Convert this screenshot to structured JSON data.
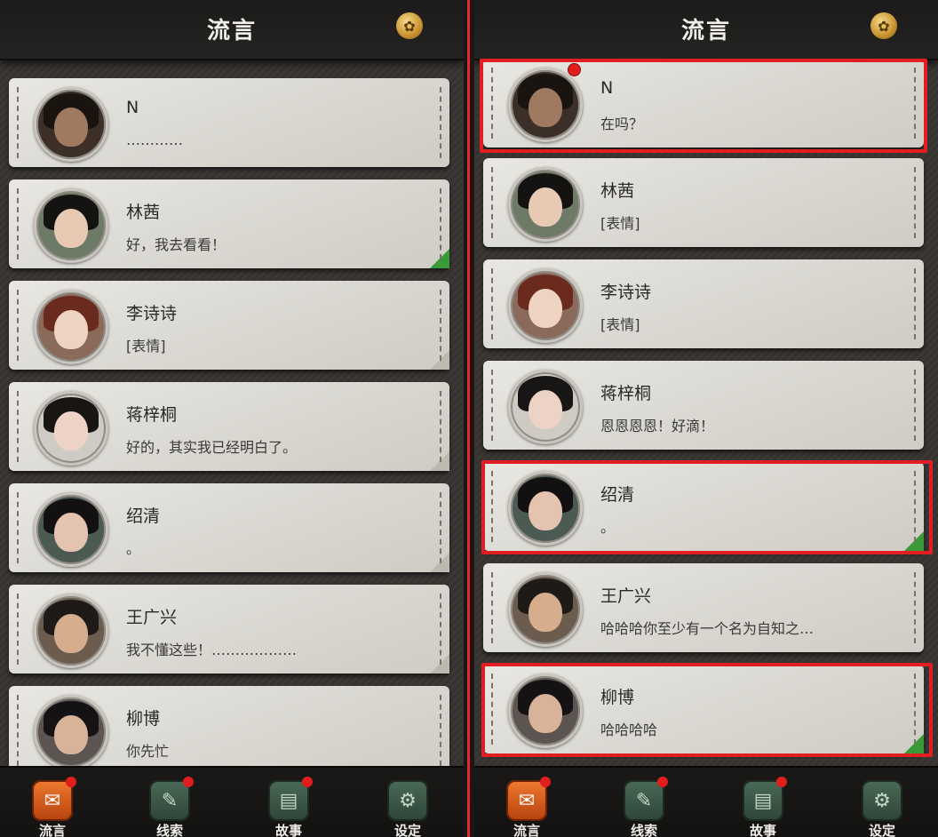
{
  "header": {
    "title": "流言",
    "badge_icon": "coin-icon"
  },
  "tabs": [
    {
      "label": "流言",
      "icon": "chat-bubble-icon",
      "active": true,
      "notify": true
    },
    {
      "label": "线索",
      "icon": "document-icon",
      "active": false,
      "notify": true
    },
    {
      "label": "故事",
      "icon": "book-icon",
      "active": false,
      "notify": true
    },
    {
      "label": "设定",
      "icon": "gear-icon",
      "active": false,
      "notify": false
    }
  ],
  "left": {
    "contacts": [
      {
        "name": "N",
        "message": "…………",
        "unread": false
      },
      {
        "name": "林茜",
        "message": "好，我去看看！",
        "unread": false
      },
      {
        "name": "李诗诗",
        "message": "[表情]",
        "unread": false
      },
      {
        "name": "蒋梓桐",
        "message": "好的，其实我已经明白了。",
        "unread": false
      },
      {
        "name": "绍清",
        "message": "。",
        "unread": false
      },
      {
        "name": "王广兴",
        "message": "我不懂这些！………………",
        "unread": false
      },
      {
        "name": "柳博",
        "message": "你先忙",
        "unread": false
      }
    ]
  },
  "right": {
    "contacts": [
      {
        "name": "N",
        "message": "在吗？",
        "unread": true
      },
      {
        "name": "林茜",
        "message": "[表情]",
        "unread": false
      },
      {
        "name": "李诗诗",
        "message": "[表情]",
        "unread": false
      },
      {
        "name": "蒋梓桐",
        "message": "恩恩恩恩！好滴！",
        "unread": false
      },
      {
        "name": "绍清",
        "message": "。",
        "unread": false
      },
      {
        "name": "王广兴",
        "message": "哈哈哈你至少有一个名为自知之…",
        "unread": false
      },
      {
        "name": "柳博",
        "message": "哈哈哈哈",
        "unread": false
      }
    ]
  },
  "colors": {
    "highlight": "#e21d24",
    "unread_dot": "#e11e1e",
    "fold": "#3a9a3a",
    "active_tab": "#f07a2f"
  }
}
